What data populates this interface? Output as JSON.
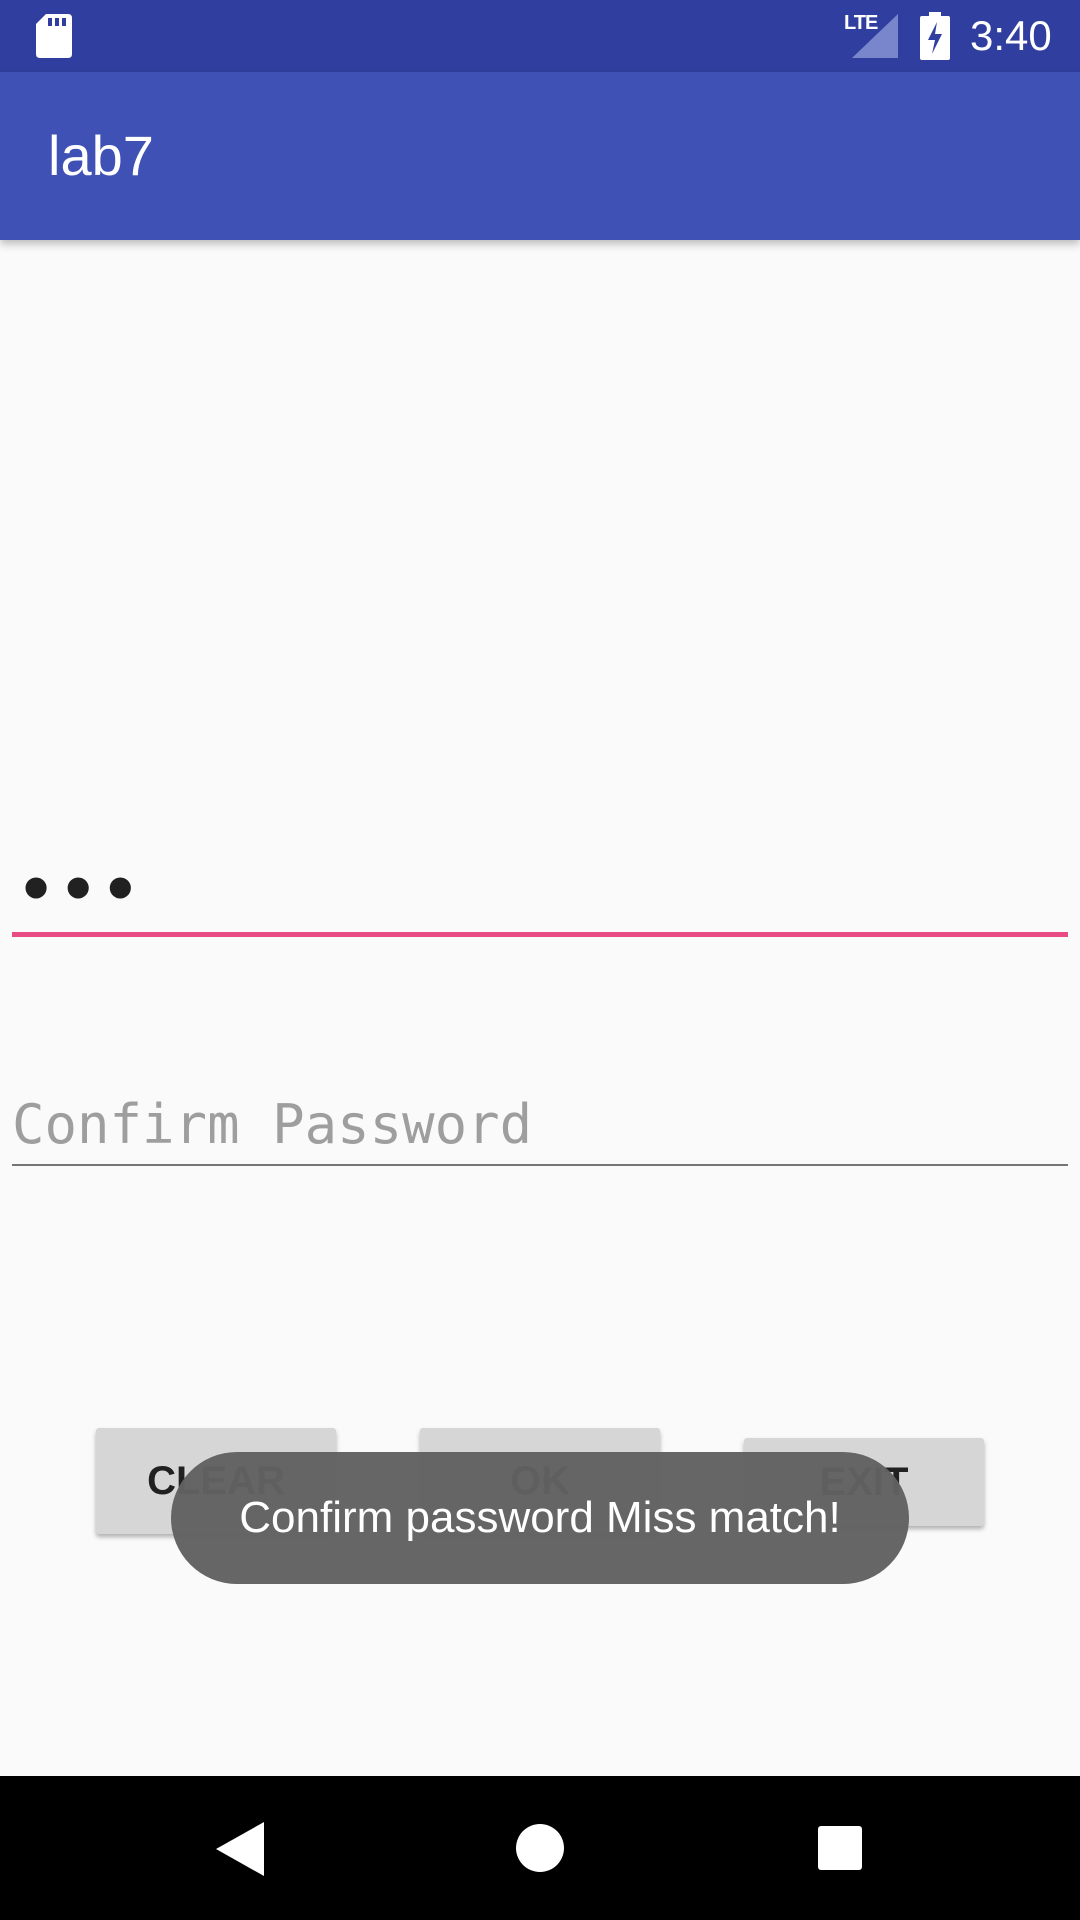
{
  "status_bar": {
    "network": "LTE",
    "time": "3:40",
    "icons": [
      "sd-card-icon",
      "signal-icon",
      "battery-charging-icon"
    ]
  },
  "app_bar": {
    "title": "lab7"
  },
  "form": {
    "password_value": "•••",
    "confirm_placeholder": "Confirm Password"
  },
  "buttons": {
    "clear": "CLEAR",
    "ok": "OK",
    "exit": "EXIT"
  },
  "toast": {
    "message": "Confirm password Miss match!"
  },
  "nav_bar": {
    "icons": [
      "back-icon",
      "home-icon",
      "recents-icon"
    ]
  },
  "colors": {
    "status_bar": "#303f9f",
    "app_bar": "#3f51b5",
    "accent": "#e94c84",
    "toast": "#616161"
  }
}
